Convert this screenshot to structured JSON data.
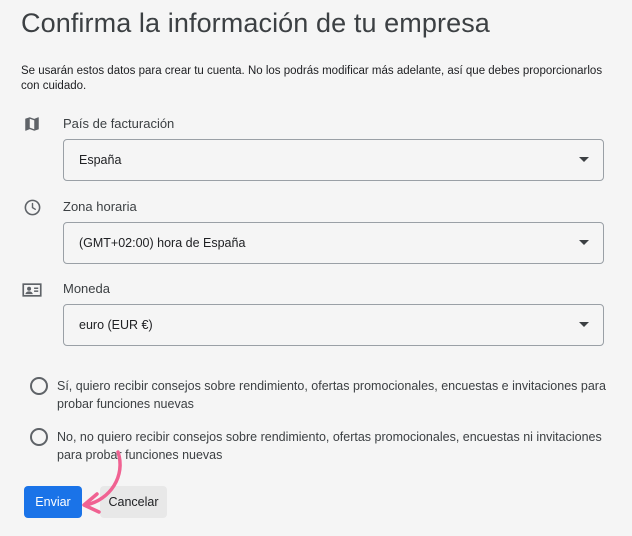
{
  "header": {
    "title": "Confirma la información de tu empresa",
    "intro": "Se usarán estos datos para crear tu cuenta. No los podrás modificar más adelante, así que debes proporcionarlos con cuidado."
  },
  "fields": {
    "billing_country": {
      "icon": "map-icon",
      "label": "País de facturación",
      "value": "España"
    },
    "timezone": {
      "icon": "clock-icon",
      "label": "Zona horaria",
      "value": "(GMT+02:00) hora de España"
    },
    "currency": {
      "icon": "currency-icon",
      "label": "Moneda",
      "value": "euro (EUR €)"
    }
  },
  "options": {
    "yes": {
      "label": "Sí, quiero recibir consejos sobre rendimiento, ofertas promocionales, encuestas e invitaciones para probar funciones nuevas",
      "selected": false
    },
    "no": {
      "label": "No, no quiero recibir consejos sobre rendimiento, ofertas promocionales, encuestas ni invitaciones para probar funciones nuevas",
      "selected": false
    }
  },
  "actions": {
    "submit_label": "Enviar",
    "cancel_label": "Cancelar"
  },
  "colors": {
    "primary": "#1a73e8",
    "annotation_arrow": "#f06292",
    "background": "#f5f5f5"
  }
}
